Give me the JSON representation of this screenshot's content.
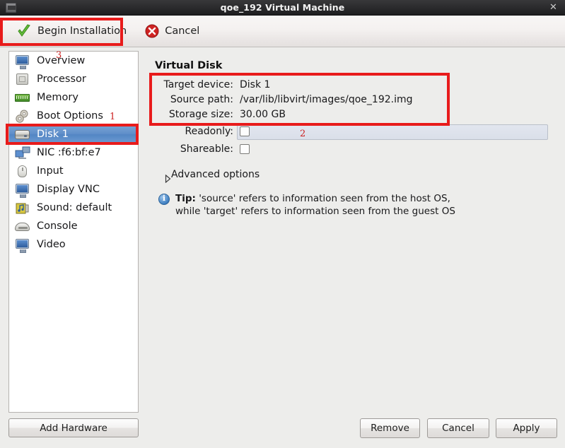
{
  "window": {
    "title": "qoe_192 Virtual Machine",
    "app_icon": "vm-icon",
    "close_label": "✕"
  },
  "toolbar": {
    "begin_installation": "Begin Installation",
    "cancel": "Cancel",
    "begin_icon": "green-check-icon",
    "cancel_icon": "red-x-icon"
  },
  "sidebar": {
    "items": [
      {
        "label": "Overview",
        "icon": "monitor-icon"
      },
      {
        "label": "Processor",
        "icon": "cpu-icon"
      },
      {
        "label": "Memory",
        "icon": "memory-icon"
      },
      {
        "label": "Boot Options",
        "icon": "gears-icon"
      },
      {
        "label": "Disk 1",
        "icon": "disk-icon"
      },
      {
        "label": "NIC :f6:bf:e7",
        "icon": "network-icon"
      },
      {
        "label": "Input",
        "icon": "mouse-icon"
      },
      {
        "label": "Display VNC",
        "icon": "monitor-icon"
      },
      {
        "label": "Sound: default",
        "icon": "sound-card-icon"
      },
      {
        "label": "Console",
        "icon": "console-icon"
      },
      {
        "label": "Video",
        "icon": "monitor-icon"
      }
    ],
    "selected_index": 4,
    "add_hardware": "Add Hardware"
  },
  "main": {
    "title": "Virtual Disk",
    "fields": [
      {
        "label": "Target device:",
        "value": "Disk 1"
      },
      {
        "label": "Source path:",
        "value": "/var/lib/libvirt/images/qoe_192.img"
      },
      {
        "label": "Storage size:",
        "value": "30.00 GB"
      }
    ],
    "readonly_label": "Readonly:",
    "readonly_checked": false,
    "shareable_label": "Shareable:",
    "shareable_checked": false,
    "advanced_options": "Advanced options",
    "advanced_expanded": false,
    "tip": {
      "prefix": "Tip:",
      "line1": "'source' refers to information seen from the host OS,",
      "line2": "while 'target' refers to information seen from the guest OS"
    }
  },
  "footer": {
    "remove": "Remove",
    "cancel": "Cancel",
    "apply": "Apply"
  },
  "annotations": {
    "n1": "1",
    "n2": "2",
    "n3": "3",
    "color": "#cc2222",
    "box_color": "#e81b1b"
  }
}
